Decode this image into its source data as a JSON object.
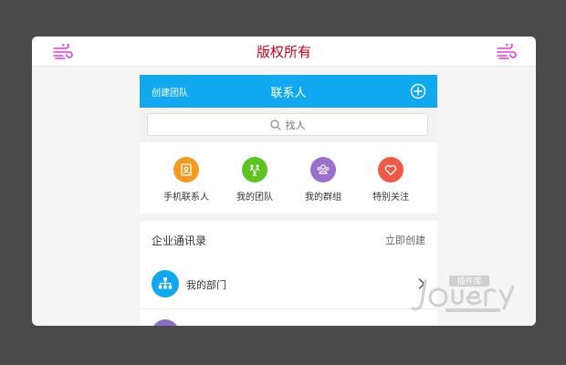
{
  "banner": {
    "copyright": "版权所有"
  },
  "header": {
    "create_team": "创建团队",
    "title": "联系人"
  },
  "search": {
    "placeholder": "找人"
  },
  "quick_actions": [
    {
      "label": "手机联系人",
      "icon": "address-book-icon",
      "color": "#f49a1e"
    },
    {
      "label": "我的团队",
      "icon": "team-icon",
      "color": "#5bc41f"
    },
    {
      "label": "我的群组",
      "icon": "group-icon",
      "color": "#9b6fcc"
    },
    {
      "label": "特别关注",
      "icon": "heart-icon",
      "color": "#ef5a44"
    }
  ],
  "directory": {
    "title": "企业通讯录",
    "action": "立即创建"
  },
  "list": [
    {
      "label": "我的部门",
      "icon": "org-chart-icon"
    }
  ],
  "colors": {
    "accent": "#10a9f0",
    "copyright": "#d0021b",
    "wind_icon": "#e83ad7"
  },
  "watermark": {
    "brand": "jQuery",
    "sub": "插件库"
  }
}
